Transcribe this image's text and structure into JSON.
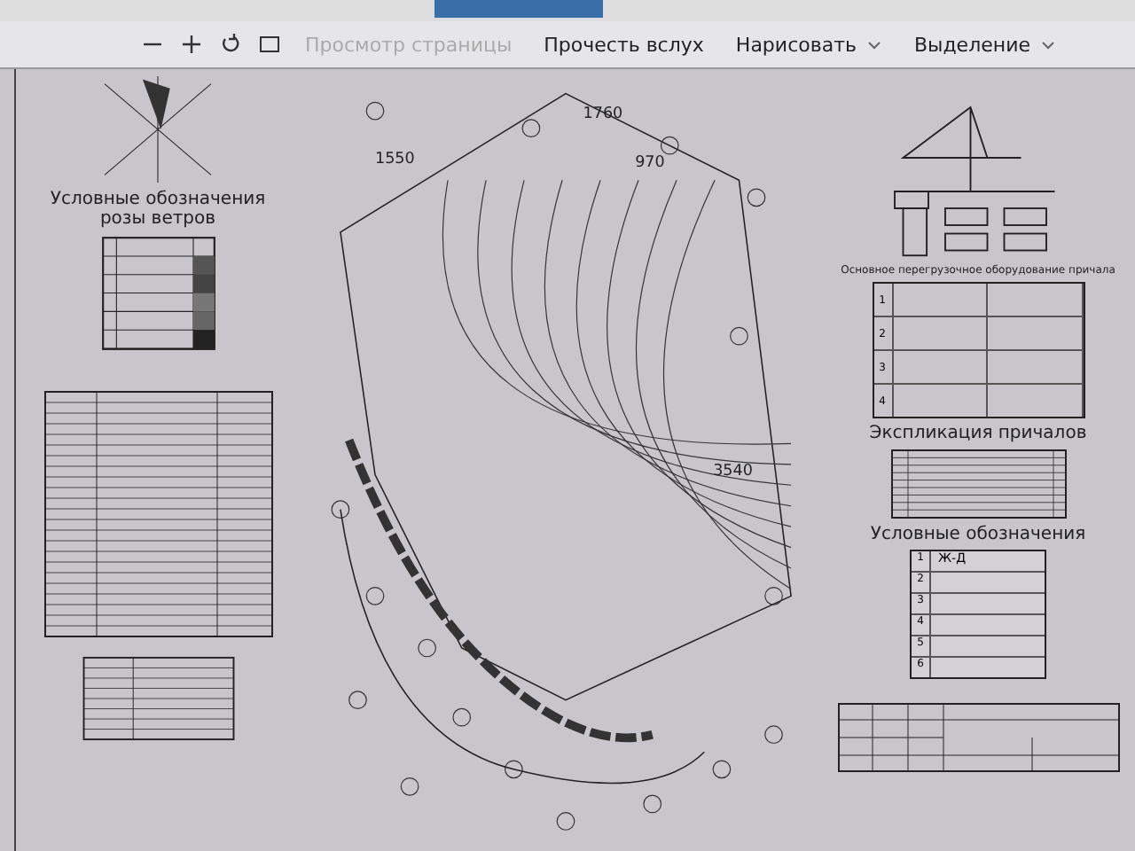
{
  "toolbar": {
    "items": [
      {
        "kind": "minus"
      },
      {
        "kind": "plus"
      },
      {
        "kind": "rotate"
      },
      {
        "kind": "fit"
      },
      {
        "kind": "button",
        "label": "Просмотр страницы",
        "disabled": true
      },
      {
        "kind": "button",
        "label": "Прочесть вслух",
        "disabled": false
      },
      {
        "kind": "menu",
        "label": "Нарисовать",
        "disabled": false
      },
      {
        "kind": "menu",
        "label": "Выделение",
        "disabled": false
      }
    ]
  },
  "drawing": {
    "wind_rose_title": "Условные обозначения розы ветров",
    "plan_dimensions": [
      "1550",
      "1760",
      "970",
      "3540"
    ],
    "equipment_title": "Основное перегрузочное оборудование причала",
    "equipment_rows": [
      "1",
      "2",
      "3",
      "4"
    ],
    "berths_title": "Экспликация причалов",
    "legend_title": "Условные обозначения",
    "legend_rows": [
      {
        "number": "1",
        "label": "Ж-Д"
      },
      {
        "number": "2",
        "label": ""
      },
      {
        "number": "3",
        "label": ""
      },
      {
        "number": "4",
        "label": ""
      },
      {
        "number": "5",
        "label": ""
      },
      {
        "number": "6",
        "label": ""
      }
    ]
  }
}
